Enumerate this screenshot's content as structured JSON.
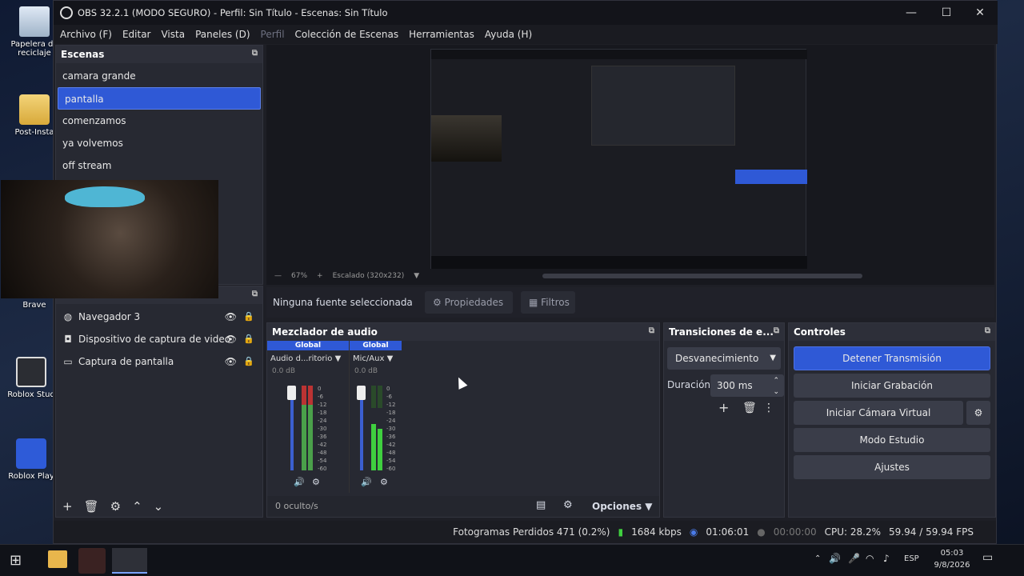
{
  "desktop": {
    "icons": [
      {
        "label": "Papelera de reciclaje"
      },
      {
        "label": "Post-Insta"
      },
      {
        "label": "Brave"
      },
      {
        "label": "Roblox Stud"
      },
      {
        "label": "Roblox Play"
      }
    ]
  },
  "window": {
    "title": "OBS 32.2.1 (MODO SEGURO) - Perfil: Sin Título - Escenas: Sin Título"
  },
  "menu": [
    "Archivo (F)",
    "Editar",
    "Vista",
    "Paneles (D)",
    "Perfil",
    "Colección de Escenas",
    "Herramientas",
    "Ayuda (H)"
  ],
  "scenes": {
    "title": "Escenas",
    "items": [
      "camara grande",
      "pantalla",
      "comenzamos",
      "ya volvemos",
      "off stream"
    ],
    "selected_index": 1
  },
  "sources": {
    "items": [
      {
        "icon": "globe-icon",
        "label": "Navegador 3"
      },
      {
        "icon": "camera-icon",
        "label": "Dispositivo de captura de video"
      },
      {
        "icon": "monitor-icon",
        "label": "Captura de pantalla"
      }
    ]
  },
  "preview": {
    "zoom": "67%",
    "scale": "Escalado (320x232)"
  },
  "context_bar": {
    "no_source": "Ninguna fuente seleccionada",
    "properties": "Propiedades",
    "filters": "Filtros"
  },
  "mixer": {
    "title": "Mezclador de audio",
    "channels": [
      {
        "tag": "Global",
        "name": "Audio d...ritorio",
        "db": "0.0 dB"
      },
      {
        "tag": "Global",
        "name": "Mic/Aux",
        "db": "0.0 dB"
      }
    ],
    "scale": [
      "0",
      "-6",
      "-12",
      "-18",
      "-24",
      "-30",
      "-36",
      "-42",
      "-48",
      "-54",
      "-60"
    ],
    "hidden": "0 oculto/s",
    "options": "Opciones"
  },
  "transitions": {
    "title": "Transiciones de e...",
    "type": "Desvanecimiento",
    "duration_label": "Duración",
    "duration": "300 ms"
  },
  "controls": {
    "title": "Controles",
    "stop_stream": "Detener Transmisión",
    "start_recording": "Iniciar Grabación",
    "start_vcam": "Iniciar Cámara Virtual",
    "studio_mode": "Modo Estudio",
    "settings": "Ajustes"
  },
  "status": {
    "dropped": "Fotogramas Perdidos 471 (0.2%)",
    "bitrate": "1684 kbps",
    "stream_time": "01:06:01",
    "rec_time": "00:00:00",
    "cpu": "CPU: 28.2%",
    "fps": "59.94 / 59.94 FPS"
  },
  "taskbar": {
    "lang": "ESP",
    "time": "05:03",
    "date": "9/8/2026"
  },
  "colors": {
    "accent": "#2f59d6",
    "bg": "#1e1f26",
    "panel": "#272932"
  }
}
